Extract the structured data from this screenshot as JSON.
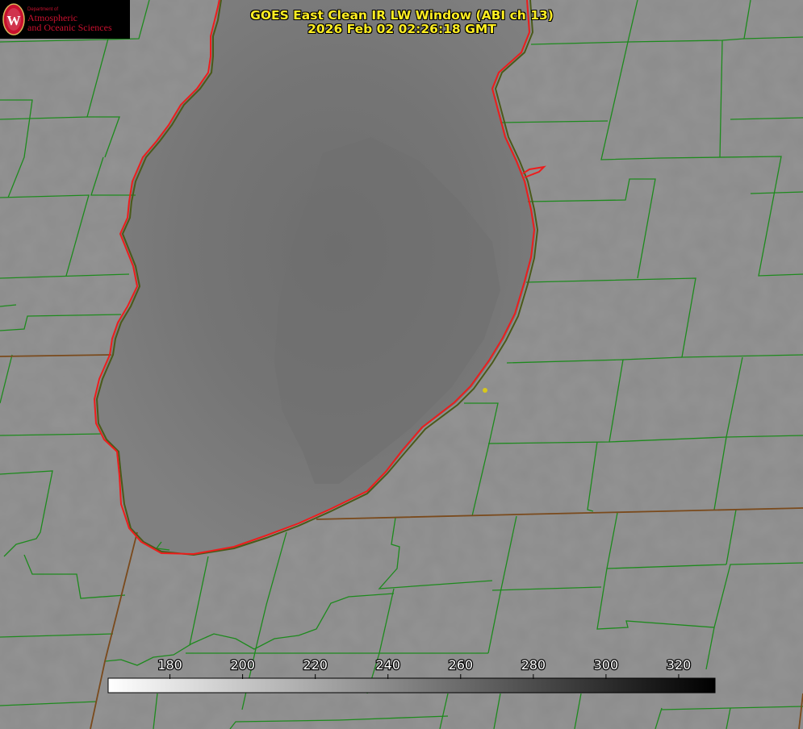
{
  "title": {
    "line1": "GOES East Clean IR LW Window (ABI ch 13)",
    "line2": "2026 Feb 02 02:26:18 GMT"
  },
  "logo": {
    "dept": "Department of",
    "line1": "Atmospheric",
    "line2": "and Oceanic Sciences",
    "seal_letter": "W",
    "icon": "uw-seal-icon"
  },
  "colorbar": {
    "ticks": [
      "180",
      "200",
      "220",
      "240",
      "260",
      "280",
      "300",
      "320"
    ],
    "min": 163,
    "max": 330,
    "low_color": "#ffffff",
    "high_color": "#000000"
  },
  "colors": {
    "background": "#8a8a8a",
    "lake": "#7f7f7f",
    "lake_core": "#6c6c6c",
    "county_lines": "#1a8a1a",
    "coastline": "#ee1c1c",
    "state_line": "#8a4a1a",
    "marker": "#d8c81a",
    "title": "#ffee22"
  }
}
